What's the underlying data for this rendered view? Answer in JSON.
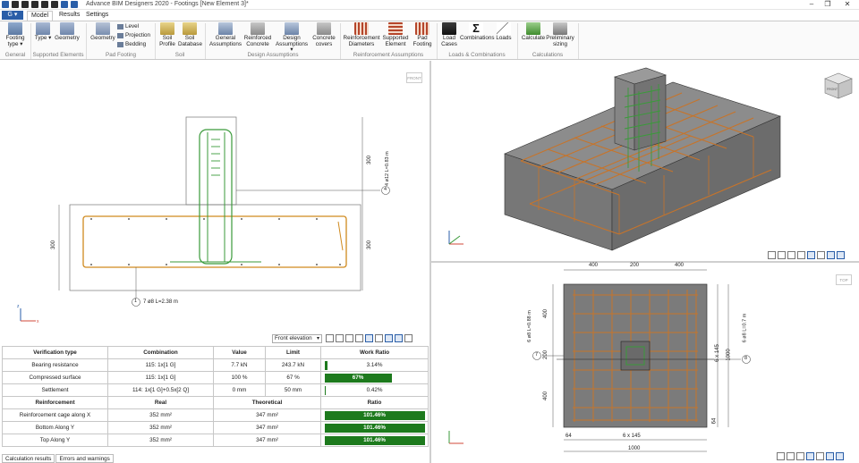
{
  "app": {
    "title": "Advance BIM Designers 2020 - Footings [New Element 3]*",
    "app_button": "G",
    "window_controls": [
      "–",
      "❐",
      "✕"
    ]
  },
  "ribbon": {
    "tabs": [
      {
        "label": "Model",
        "active": true
      },
      {
        "label": "Results",
        "active": false
      },
      {
        "label": "Settings",
        "active": false
      }
    ],
    "buttons": {
      "footing_type": "Footing type",
      "type": "Type",
      "geometry_support": "Geometry",
      "geometry_pad": "Geometry",
      "level": "Level",
      "projection": "Projection",
      "bedding": "Bedding",
      "soil_profile": "Soil Profile",
      "soil_database": "Soil Database",
      "general_assumptions": "General Assumptions",
      "reinforced_concrete": "Reinforced Concrete",
      "design_assumptions": "Design Assumptions",
      "concrete_covers": "Concrete covers",
      "reinforcement_diameters": "Reinforcement Diameters",
      "supported_element": "Supported Element",
      "pad_footing": "Pad Footing",
      "load_cases": "Load Cases",
      "combinations": "Combinations",
      "loads": "Loads",
      "calculate": "Calculate",
      "preliminary_sizing": "Preliminary sizing"
    },
    "groups": {
      "general": "General",
      "supported_elements": "Supported Elements",
      "pad_footing": "Pad Footing",
      "soil": "Soil",
      "design_assumptions": "Design Assumptions",
      "reinforcement_assumptions": "Reinforcement Assumptions",
      "loads_combinations": "Loads & Combinations",
      "calculations": "Calculations"
    }
  },
  "front_view": {
    "tag": "FRONT",
    "dim_column_height": "300",
    "dim_footing_height_right": "300",
    "dim_footing_height_left": "300",
    "callout_4": "4",
    "callout_4_text": "4 ø12 L=0.83 m",
    "callout_1": "1",
    "callout_1_text": "7 ø8 L=2.38 m",
    "view_select": "Front elevation"
  },
  "iso_view": {
    "cube_label": "FRONT"
  },
  "top_view": {
    "tag": "TOP",
    "dim_top": [
      "400",
      "200",
      "400"
    ],
    "dim_left": [
      "400",
      "200",
      "400"
    ],
    "dim_bottom_small": "64",
    "dim_bottom_span": "6 x 145",
    "dim_bottom_total": "1000",
    "dim_right_span": "6 x 145",
    "dim_right_total": "1000",
    "dim_right_small": "64",
    "callout_7": "7",
    "callout_7_text": "6 ø8 L=0.88 m",
    "callout_8": "8",
    "callout_8_text": "6 ø8 L=0.7 m"
  },
  "verification": {
    "headers": [
      "Verification type",
      "Combination",
      "Value",
      "Limit",
      "Work Ratio"
    ],
    "rows": [
      {
        "type": "Bearing resistance",
        "combination": "115: 1x[1 G]",
        "value": "7.7 kN",
        "limit": "243.7 kN",
        "ratio": "3.14%",
        "ratio_value": 3.14
      },
      {
        "type": "Compressed surface",
        "combination": "115: 1x[1 G]",
        "value": "100 %",
        "limit": "67 %",
        "ratio": "67%",
        "ratio_value": 67
      },
      {
        "type": "Settlement",
        "combination": "114: 1x[1 G]+0.5x[2 Q]",
        "value": "0 mm",
        "limit": "50 mm",
        "ratio": "0.42%",
        "ratio_value": 0.42
      }
    ],
    "reinforcement_headers": [
      "Reinforcement",
      "Real",
      "Theoretical",
      "Ratio"
    ],
    "reinforcement_rows": [
      {
        "name": "Reinforcement cage along X",
        "real": "352 mm²",
        "theoretical": "347 mm²",
        "ratio": "101.46%",
        "ratio_value": 100
      },
      {
        "name": "Bottom Along Y",
        "real": "352 mm²",
        "theoretical": "347 mm²",
        "ratio": "101.46%",
        "ratio_value": 100
      },
      {
        "name": "Top Along Y",
        "real": "352 mm²",
        "theoretical": "347 mm²",
        "ratio": "101.46%",
        "ratio_value": 100
      }
    ]
  },
  "bottom_tabs": [
    "Calculation results",
    "Errors and warnings"
  ],
  "colors": {
    "rebar": "#d08a1e",
    "rebar_green": "#3a9a3a",
    "accent": "#2a5ea8",
    "ratio_green": "#1d7a1d"
  }
}
